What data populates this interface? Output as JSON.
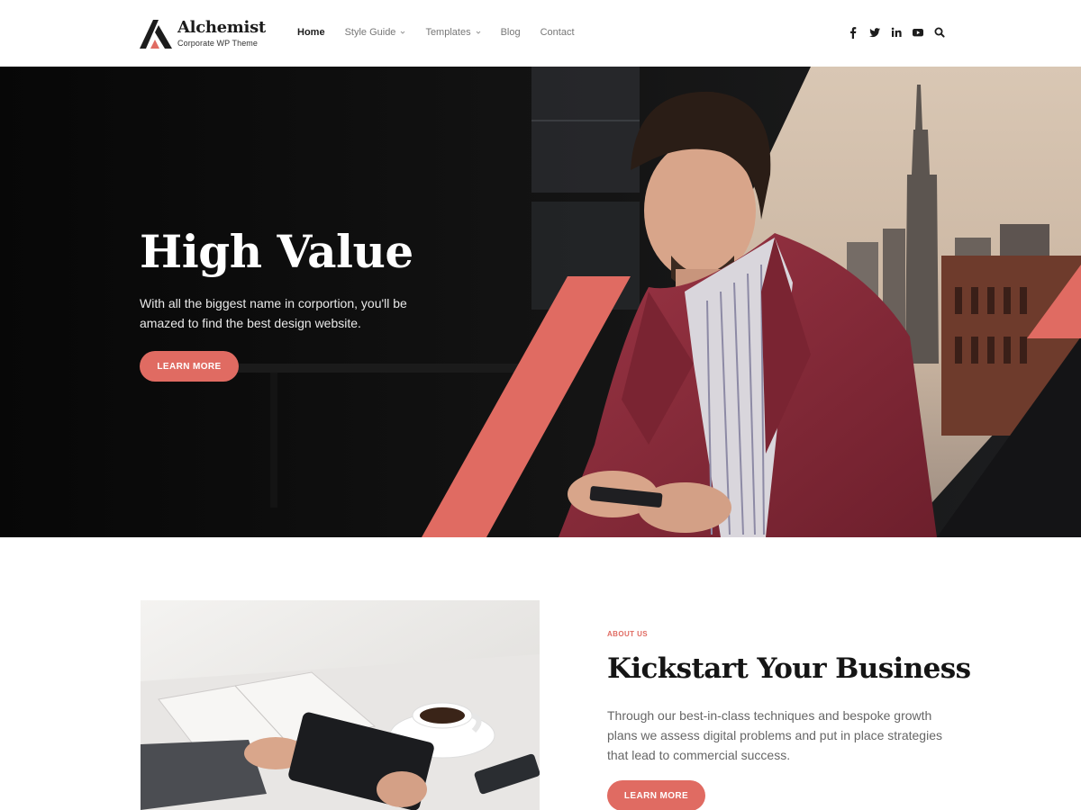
{
  "header": {
    "logo_title": "Alchemist",
    "logo_tagline": "Corporate WP Theme",
    "nav": [
      {
        "label": "Home",
        "active": true
      },
      {
        "label": "Style Guide",
        "dropdown": true
      },
      {
        "label": "Templates",
        "dropdown": true
      },
      {
        "label": "Blog"
      },
      {
        "label": "Contact"
      }
    ],
    "social_icons": [
      "facebook-icon",
      "twitter-icon",
      "linkedin-icon",
      "youtube-icon",
      "search-icon"
    ]
  },
  "hero": {
    "title": "High Value",
    "text": "With all the biggest name in corportion, you'll be amazed to find the best design website.",
    "button_label": "LEARN MORE"
  },
  "about": {
    "kicker": "ABOUT US",
    "title": "Kickstart Your Business",
    "text": "Through our best-in-class techniques and bespoke growth plans we assess digital problems and put in place strategies that lead to commercial success.",
    "button_label": "LEARN MORE"
  },
  "colors": {
    "accent": "#e06b62",
    "dark": "#1c1c1c",
    "text_muted": "#666666",
    "jacket": "#8e2a3a"
  }
}
